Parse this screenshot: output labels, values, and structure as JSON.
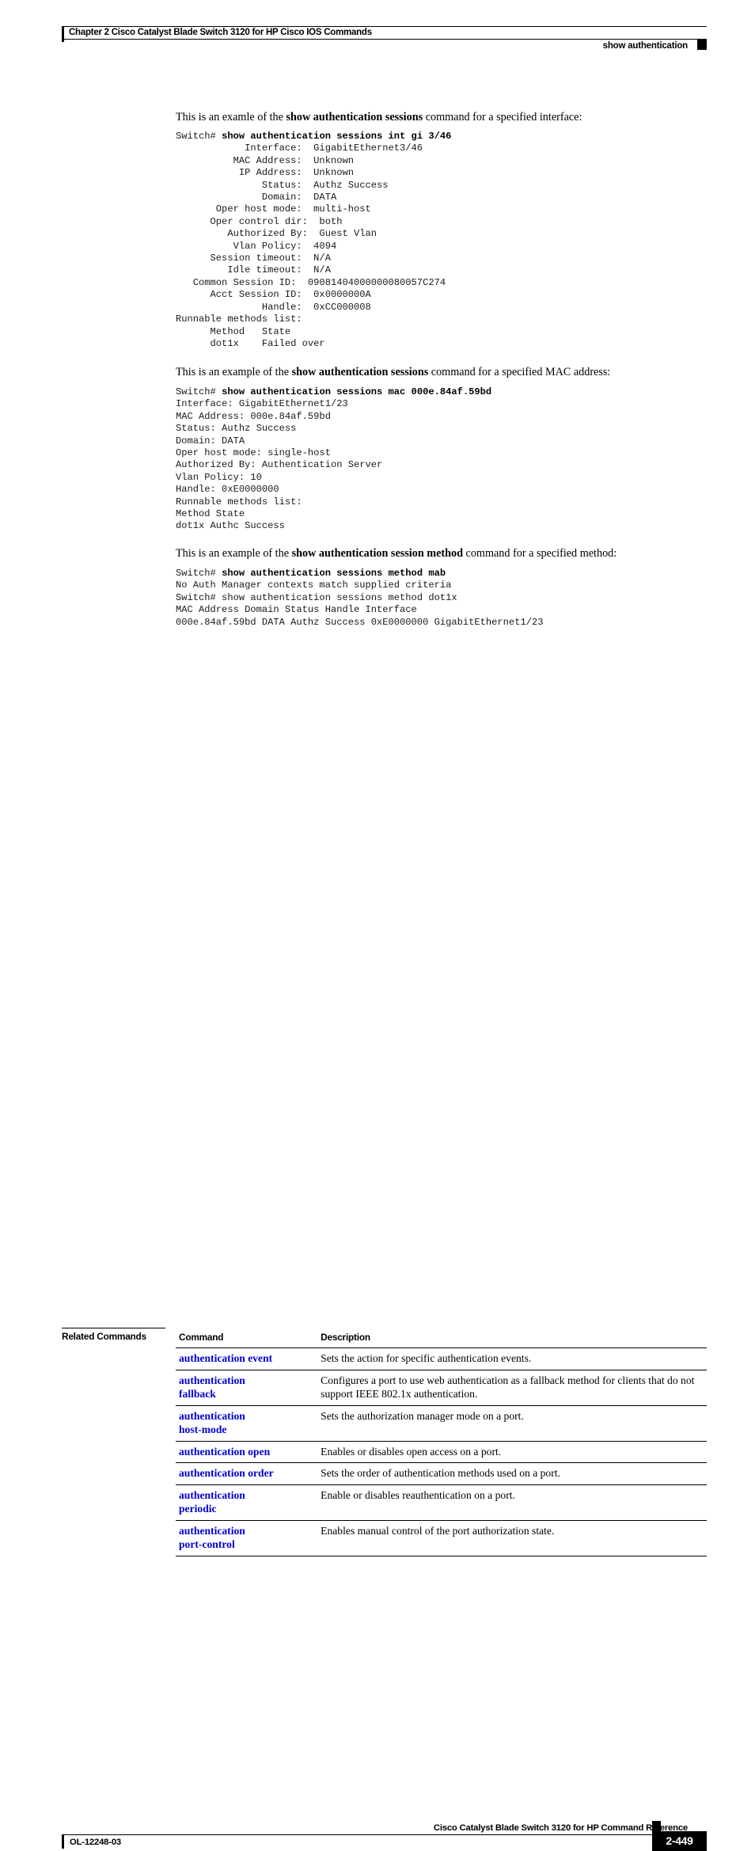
{
  "header": {
    "chapter": "Chapter  2 Cisco Catalyst Blade Switch 3120 for HP Cisco IOS Commands",
    "running_head": "show authentication"
  },
  "examples": [
    {
      "intro_before": "This is an examle of the ",
      "intro_bold": "show authentication sessions",
      "intro_after": " command for a specified interface:",
      "prompt": "Switch# ",
      "command": "show authentication sessions int gi 3/46",
      "output": "            Interface:  GigabitEthernet3/46\n          MAC Address:  Unknown\n           IP Address:  Unknown\n               Status:  Authz Success\n               Domain:  DATA\n       Oper host mode:  multi-host\n      Oper control dir:  both\n         Authorized By:  Guest Vlan\n          Vlan Policy:  4094\n      Session timeout:  N/A\n         Idle timeout:  N/A\n   Common Session ID:  09081404000000080057C274\n      Acct Session ID:  0x0000000A\n               Handle:  0xCC000008\nRunnable methods list:\n      Method   State\n      dot1x    Failed over"
    },
    {
      "intro_before": "This is an example of the ",
      "intro_bold": "show authentication sessions",
      "intro_after": " command for a specified MAC address:",
      "prompt": "Switch# ",
      "command": "show authentication sessions mac 000e.84af.59bd",
      "output": "Interface: GigabitEthernet1/23\nMAC Address: 000e.84af.59bd\nStatus: Authz Success\nDomain: DATA\nOper host mode: single-host\nAuthorized By: Authentication Server\nVlan Policy: 10\nHandle: 0xE0000000\nRunnable methods list:\nMethod State\ndot1x Authc Success"
    },
    {
      "intro_before": "This is an example of the ",
      "intro_bold": "show authentication session method",
      "intro_after": " command for a specified method:",
      "prompt": "Switch# ",
      "command": "show authentication sessions method mab",
      "output": "No Auth Manager contexts match supplied criteria\nSwitch# show authentication sessions method dot1x\nMAC Address Domain Status Handle Interface\n000e.84af.59bd DATA Authz Success 0xE0000000 GigabitEthernet1/23"
    }
  ],
  "related_commands": {
    "section_label": "Related Commands",
    "columns": [
      "Command",
      "Description"
    ],
    "rows": [
      {
        "command": "authentication event",
        "description": "Sets the action for specific authentication events."
      },
      {
        "command": "authentication\nfallback",
        "description": "Configures a port to use web authentication as a fallback method for clients that do not support IEEE 802.1x authentication."
      },
      {
        "command": "authentication\nhost-mode",
        "description": "Sets the authorization manager mode on a port."
      },
      {
        "command": "authentication open",
        "description": "Enables or disables open access on a port."
      },
      {
        "command": "authentication order",
        "description": "Sets the order of authentication methods used on a port."
      },
      {
        "command": "authentication\nperiodic",
        "description": "Enable or disables reauthentication on a port."
      },
      {
        "command": "authentication\nport-control",
        "description": "Enables manual control of the port authorization state."
      }
    ]
  },
  "footer": {
    "doc_id": "OL-12248-03",
    "book_title": "Cisco Catalyst Blade Switch 3120 for HP Command Reference",
    "page_number": "2-449"
  },
  "colors": {
    "link": "#0000d5",
    "text": "#000000",
    "rule": "#000000"
  }
}
